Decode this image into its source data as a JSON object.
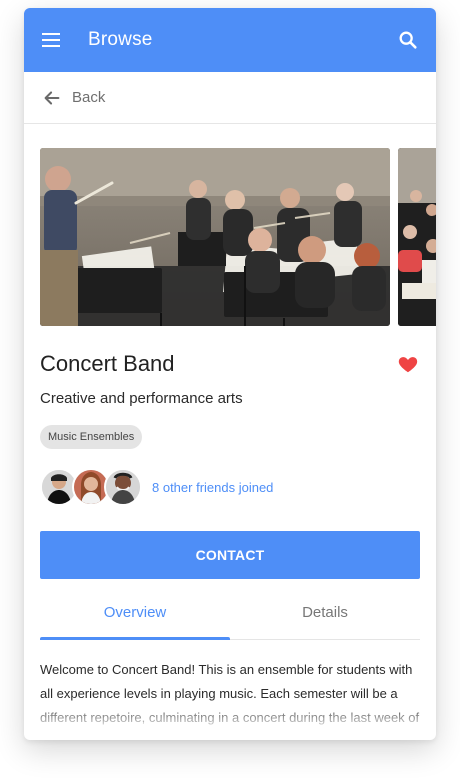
{
  "appbar": {
    "title": "Browse",
    "menu_icon": "menu-icon",
    "search_icon": "search-icon",
    "color": "#4e8ef7"
  },
  "back": {
    "label": "Back",
    "icon": "arrow-left-icon"
  },
  "gallery": {
    "images": [
      "concert band rehearsal photo",
      "orchestra rehearsal photo"
    ]
  },
  "club": {
    "title": "Concert Band",
    "subtitle": "Creative and performance arts",
    "tag": "Music Ensembles",
    "favorite_color": "#ef4444"
  },
  "friends": {
    "label": "8 other friends joined"
  },
  "actions": {
    "contact_label": "CONTACT"
  },
  "tabs": [
    {
      "label": "Overview",
      "active": true
    },
    {
      "label": "Details",
      "active": false
    }
  ],
  "description": "Welcome to Concert Band! This is an ensemble for students with all experience levels in playing music. Each semester will be a different repetoire, culminating in a concert during the last week of the semester."
}
